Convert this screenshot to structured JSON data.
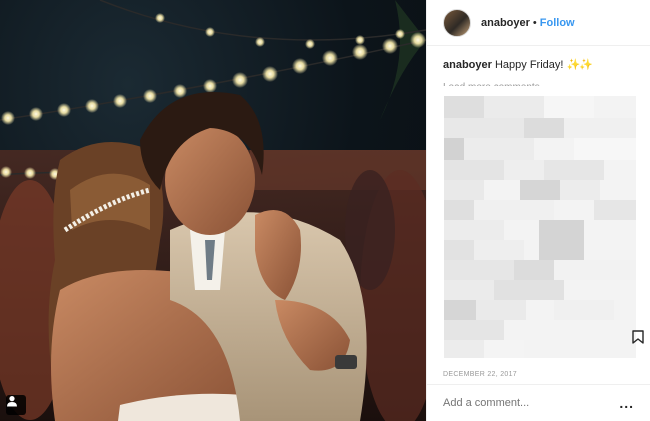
{
  "post": {
    "username": "anaboyer",
    "follow_separator": "•",
    "follow_label": "Follow",
    "caption_user": "anaboyer",
    "caption_text": "Happy Friday!",
    "caption_emoji": "✨✨",
    "load_more_label": "Load more comments",
    "date": "DECEMBER 22, 2017",
    "comment_placeholder": "Add a comment...",
    "more_options": "..."
  },
  "colors": {
    "follow_link": "#3897f0",
    "muted_text": "#999999",
    "border": "#efefef"
  },
  "icons": {
    "user_tag": "user-tag-icon",
    "bookmark": "bookmark-icon",
    "more": "more-options-icon"
  }
}
